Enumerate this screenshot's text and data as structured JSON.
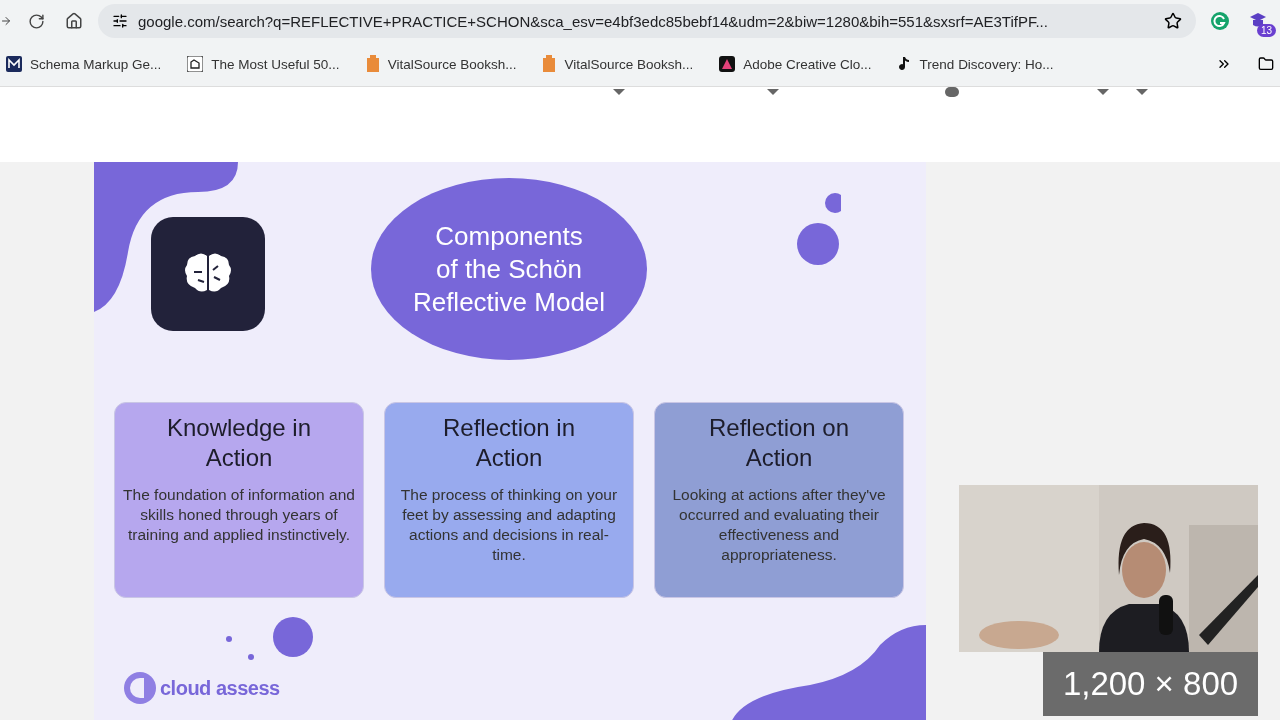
{
  "browser": {
    "url": "google.com/search?q=REFLECTIVE+PRACTICE+SCHON&sca_esv=e4bf3edc85bebf14&udm=2&biw=1280&bih=551&sxsrf=AE3TifPF...",
    "extension_badge": "13",
    "bookmarks": [
      {
        "label": "Schema Markup Ge..."
      },
      {
        "label": "The Most Useful 50..."
      },
      {
        "label": "VitalSource Booksh..."
      },
      {
        "label": "VitalSource Booksh..."
      },
      {
        "label": "Adobe Creative Clo..."
      },
      {
        "label": "Trend Discovery: Ho..."
      }
    ]
  },
  "infographic": {
    "title": "Components\nof the Schön\nReflective Model",
    "cards": [
      {
        "title": "Knowledge in\nAction",
        "text": "The foundation of information and skills honed through years of training and applied instinctively.",
        "color": "#b6a7ee"
      },
      {
        "title": "Reflection in\nAction",
        "text": "The process of thinking on your feet by assessing and adapting actions and decisions in real-time.",
        "color": "#98aaee"
      },
      {
        "title": "Reflection on\nAction",
        "text": "Looking at actions after they've occurred and evaluating their effectiveness and appropriateness.",
        "color": "#8f9ed4"
      }
    ],
    "logo": "cloud assess"
  },
  "dimensions": "1,200 × 800"
}
